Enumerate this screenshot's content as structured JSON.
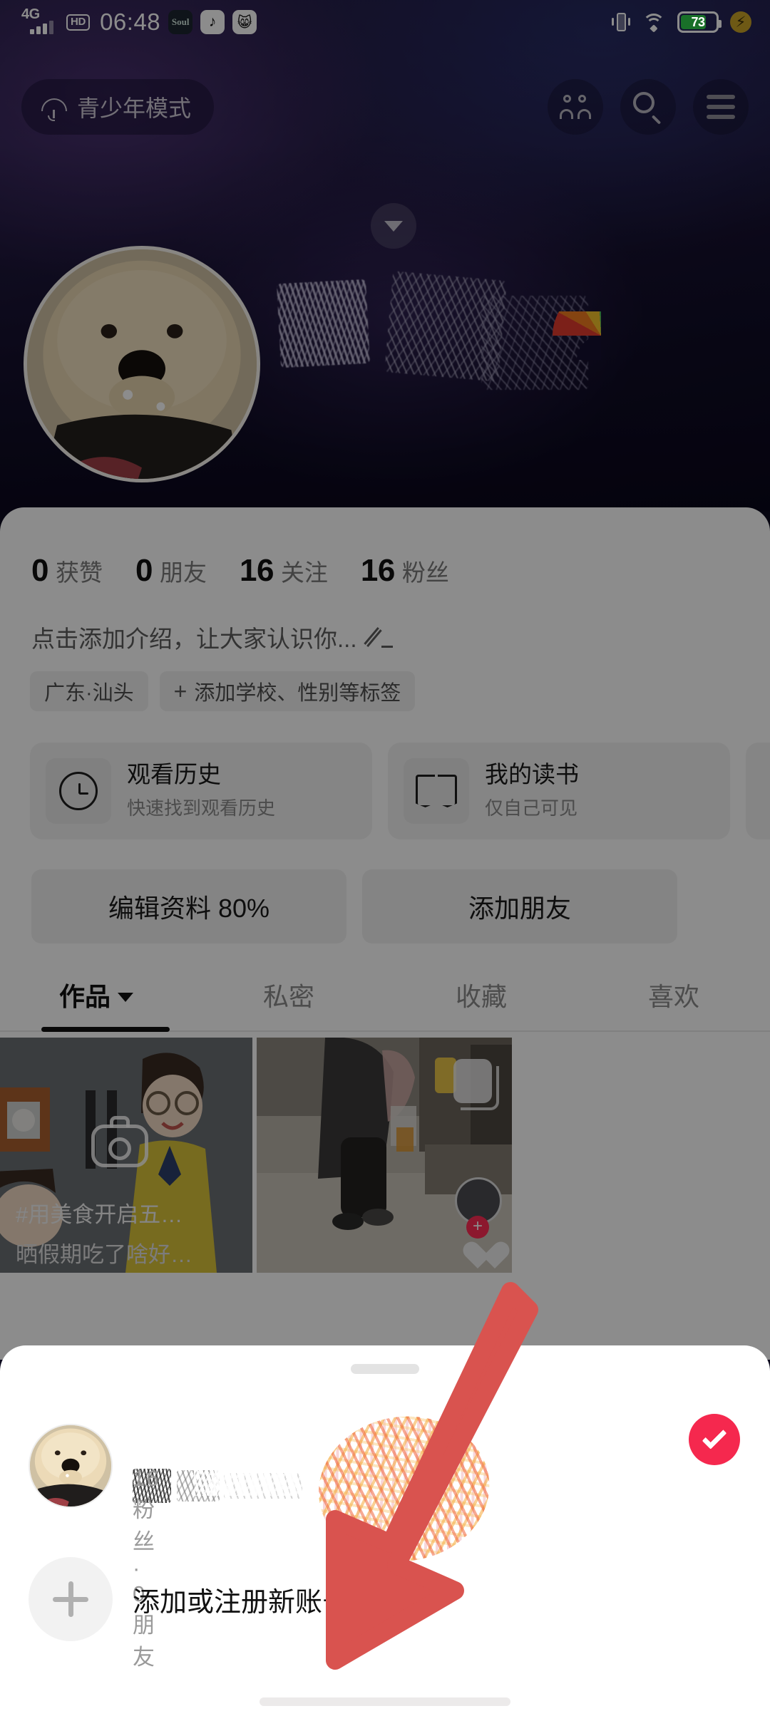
{
  "status_bar": {
    "network": "4G",
    "hd": "HD",
    "time": "06:48",
    "app_icons": [
      "Soul",
      "music-app-icon",
      "cat-app-icon"
    ],
    "battery_percent": "73",
    "icons": [
      "vibrate-icon",
      "wifi-icon",
      "battery-icon",
      "fast-charge-icon"
    ]
  },
  "header": {
    "teen_mode_label": "青少年模式",
    "umbrella_icon": "umbrella-icon",
    "actions": [
      {
        "name": "friends-icon",
        "label": "好友"
      },
      {
        "name": "search-icon",
        "label": "搜索"
      },
      {
        "name": "menu-icon",
        "label": "菜单"
      }
    ]
  },
  "profile": {
    "avatar": "dog-avatar",
    "username_redacted": "",
    "expand_icon": "chevron-down-icon",
    "stats": [
      {
        "value": "0",
        "label": "获赞"
      },
      {
        "value": "0",
        "label": "朋友"
      },
      {
        "value": "16",
        "label": "关注"
      },
      {
        "value": "16",
        "label": "粉丝"
      }
    ],
    "bio_placeholder": "点击添加介绍，让大家认识你...",
    "edit_icon": "pencil-icon",
    "tags": [
      {
        "label": "广东·汕头",
        "has_plus": false
      },
      {
        "label": "添加学校、性别等标签",
        "has_plus": true
      }
    ],
    "mini_cards": [
      {
        "icon": "clock-icon",
        "title": "观看历史",
        "subtitle": "快速找到观看历史"
      },
      {
        "icon": "book-icon",
        "title": "我的读书",
        "subtitle": "仅自己可见"
      },
      {
        "icon": "music-note-icon",
        "title": "",
        "subtitle": ""
      }
    ],
    "buttons": [
      {
        "label": "编辑资料 80%"
      },
      {
        "label": "添加朋友"
      }
    ],
    "tabs": [
      {
        "label": "作品",
        "active": true,
        "has_caret": true
      },
      {
        "label": "私密",
        "active": false,
        "has_caret": false
      },
      {
        "label": "收藏",
        "active": false,
        "has_caret": false
      },
      {
        "label": "喜欢",
        "active": false,
        "has_caret": false
      }
    ],
    "grid": [
      {
        "caption_top": "#用美食开启五…",
        "caption_bottom": "晒假期吃了啥好…",
        "icon": "shopping-cart-icon"
      },
      {
        "caption_top": "",
        "caption_bottom": "",
        "icon": "duplicate-icon"
      }
    ]
  },
  "sheet": {
    "grabber": "drag-handle",
    "account": {
      "avatar": "dog-avatar",
      "name_redacted": "",
      "meta": "16 粉丝 · 0 朋友",
      "selected_icon": "check-circle-icon"
    },
    "add_account": {
      "plus_icon": "plus-icon",
      "label": "添加或注册新账号"
    }
  },
  "annotation": {
    "arrow": "red-pointer-arrow",
    "arrow_color": "#d9534f",
    "points_to": "添加或注册新账号"
  },
  "colors": {
    "accent_red": "#f5284e",
    "battery_green": "#2ecc4b",
    "arrow_red": "#d9534f",
    "sheet_bg": "#ffffff"
  }
}
